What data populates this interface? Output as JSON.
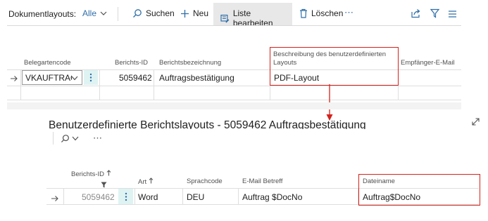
{
  "toolbar": {
    "title": "Dokumentlayouts:",
    "filter_label": "Alle",
    "search_label": "Suchen",
    "new_label": "Neu",
    "edit_list_label": "Liste bearbeiten",
    "delete_label": "Löschen",
    "more": "⋯"
  },
  "top_table": {
    "headers": {
      "belegartencode": "Belegartencode",
      "berichts_id": "Berichts-ID",
      "berichtsbezeichnung": "Berichtsbezeichnung",
      "beschreibung_line1": "Beschreibung des benutzerdefinierten",
      "beschreibung_line2": "Layouts",
      "empfaenger": "Empfänger-E-Mail"
    },
    "row": {
      "belegartencode": "VKAUFTRAG",
      "berichts_id": "5059462",
      "berichtsbezeichnung": "Auftragsbestätigung",
      "beschreibung": "PDF-Layout"
    }
  },
  "bottom_panel": {
    "title": "Benutzerdefinierte Berichtslayouts - 5059462 Auftragsbestätigung",
    "more": "⋯",
    "headers": {
      "berichts_id": "Berichts-ID",
      "art": "Art",
      "sprachcode": "Sprachcode",
      "email_betreff": "E-Mail Betreff",
      "dateiname": "Dateiname"
    },
    "row": {
      "berichts_id": "5059462",
      "art": "Word",
      "sprachcode": "DEU",
      "email_betreff": "Auftrag $DocNo",
      "dateiname": "Auftrag$DocNo"
    }
  },
  "colors": {
    "accent": "#2f6ea8",
    "highlight_red": "#d3221c",
    "selected_bg": "#e8e8e8",
    "row_action_bg": "#dff3f3"
  }
}
